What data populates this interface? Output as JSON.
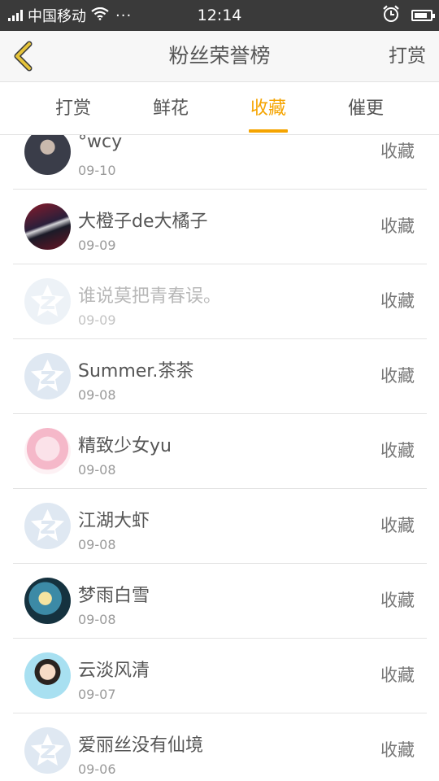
{
  "status_bar": {
    "carrier": "中国移动",
    "time": "12:14",
    "more": "···"
  },
  "header": {
    "back_icon": "chevron-left-icon",
    "title": "粉丝荣誉榜",
    "action": "打赏"
  },
  "colors": {
    "accent": "#f5a400",
    "back_icon": "#e6c43a"
  },
  "tabs": [
    {
      "label": "打赏",
      "active": false
    },
    {
      "label": "鲜花",
      "active": false
    },
    {
      "label": "收藏",
      "active": true
    },
    {
      "label": "催更",
      "active": false
    }
  ],
  "list": [
    {
      "name": "°wcy",
      "date": "09-10",
      "action": "收藏",
      "avatar": "photo"
    },
    {
      "name": "大橙子de大橘子",
      "date": "09-09",
      "action": "收藏",
      "avatar": "photo"
    },
    {
      "name": "谁说莫把青春误。",
      "date": "09-09",
      "action": "收藏",
      "avatar": "default"
    },
    {
      "name": "Summer.茶茶",
      "date": "09-08",
      "action": "收藏",
      "avatar": "default"
    },
    {
      "name": "精致少女yu",
      "date": "09-08",
      "action": "收藏",
      "avatar": "photo"
    },
    {
      "name": "江湖大虾",
      "date": "09-08",
      "action": "收藏",
      "avatar": "default"
    },
    {
      "name": "梦雨白雪",
      "date": "09-08",
      "action": "收藏",
      "avatar": "photo"
    },
    {
      "name": "云淡风清",
      "date": "09-07",
      "action": "收藏",
      "avatar": "photo"
    },
    {
      "name": "爱丽丝没有仙境",
      "date": "09-06",
      "action": "收藏",
      "avatar": "default"
    }
  ]
}
